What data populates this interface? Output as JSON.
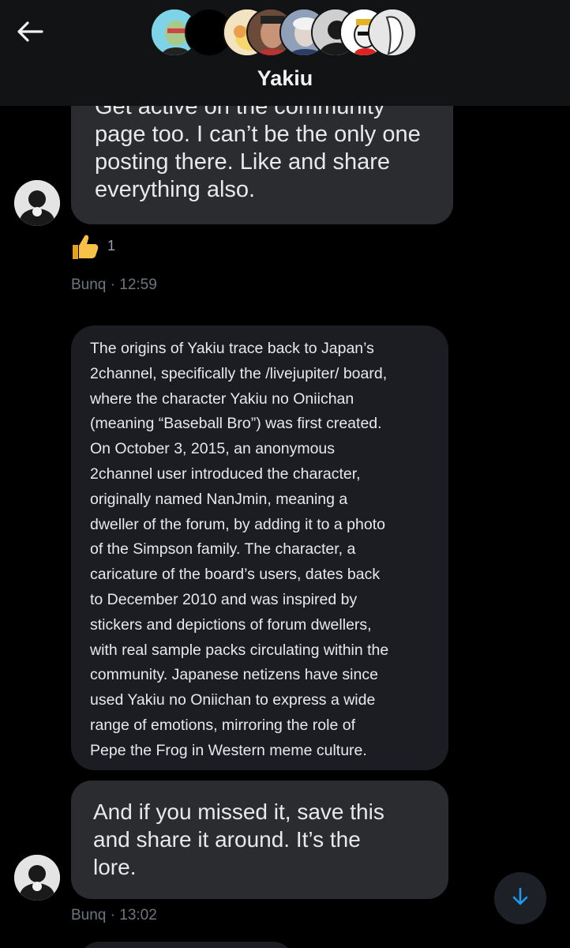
{
  "header": {
    "title": "Yakiu",
    "participants": [
      "avatar-1",
      "avatar-2",
      "avatar-3",
      "avatar-4",
      "avatar-5",
      "avatar-6",
      "avatar-7",
      "avatar-8"
    ]
  },
  "messages": [
    {
      "text": "Get active on the community page too. I can’t be the only one posting there. Like and share everything also.",
      "lines": [
        "Get active on the community",
        "page too. I can’t be the only one",
        "posting there. Like and share",
        "everything also."
      ],
      "reaction": {
        "icon": "thumbs-up-icon",
        "count": "1"
      },
      "sender": "Bunq",
      "time": "· 12:59"
    },
    {
      "lines": [
        "The origins of Yakiu trace back to Japan’s",
        "2channel, specifically the /livejupiter/ board,",
        "where the character Yakiu no Oniichan",
        "(meaning “Baseball Bro”) was first created.",
        "On October 3, 2015, an anonymous",
        "2channel user introduced the character,",
        "originally named NanJmin, meaning a",
        "dweller of the forum, by adding it to a photo",
        "of the Simpson family. The character, a",
        "caricature of the board’s users, dates back",
        "to December 2010 and was inspired by",
        "stickers and depictions of forum dwellers,",
        "with real sample packs circulating within the",
        "community. Japanese netizens have since",
        "used Yakiu no Oniichan to express a wide",
        "range of emotions, mirroring the role of",
        "Pepe the Frog in Western meme culture."
      ]
    },
    {
      "lines": [
        "And if you missed it, save this",
        "and share it around. It’s the",
        "lore."
      ],
      "sender": "Bunq",
      "time": "· 13:02"
    }
  ],
  "icons": {
    "back": "back-arrow-icon",
    "scroll": "arrow-down-icon"
  },
  "colors": {
    "background": "#000000",
    "header": "#111315",
    "bubble": "#2a2c30",
    "accent": "#1d9bf0"
  }
}
